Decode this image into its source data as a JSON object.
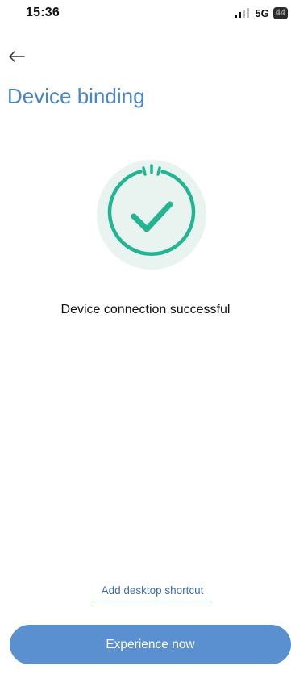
{
  "status_bar": {
    "time": "15:36",
    "network": "5G",
    "battery": "44",
    "icons": [
      "signal-icon",
      "battery-icon"
    ]
  },
  "header": {
    "back_icon": "arrow-left-icon",
    "title": "Device binding"
  },
  "main": {
    "success_icon": "check-circle-icon",
    "message": "Device connection successful",
    "accent_color": "#23b493",
    "graphic_bg_color": "#e9f4f1"
  },
  "footer": {
    "shortcut_label": "Add desktop shortcut",
    "primary_button_label": "Experience now",
    "button_color": "#5a8fd0",
    "title_color": "#4a86c5"
  }
}
